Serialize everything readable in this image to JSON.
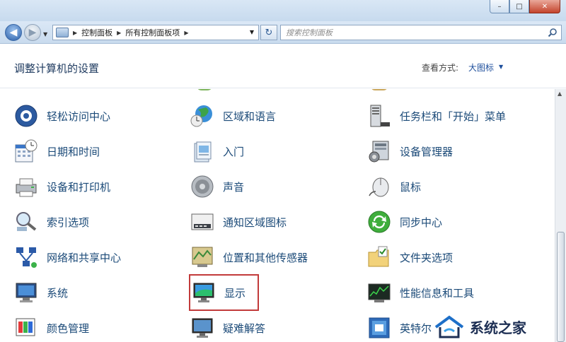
{
  "titlebar": {
    "minimize_symbol": "–",
    "maximize_symbol": "□",
    "close_symbol": "✕"
  },
  "address": {
    "back_symbol": "◀",
    "forward_symbol": "▶",
    "crumbs": [
      "控制面板",
      "所有控制面板项"
    ],
    "refresh_symbol": "↻",
    "search_placeholder": "搜索控制面板"
  },
  "header": {
    "title": "调整计算机的设置",
    "view_label": "查看方式:",
    "view_value": "大图标"
  },
  "items": [
    {
      "label": "轻松访问中心",
      "icon": "ease-of-access-icon"
    },
    {
      "label": "区域和语言",
      "icon": "region-language-icon"
    },
    {
      "label": "任务栏和「开始」菜单",
      "icon": "taskbar-icon"
    },
    {
      "label": "日期和时间",
      "icon": "date-time-icon"
    },
    {
      "label": "入门",
      "icon": "getting-started-icon"
    },
    {
      "label": "设备管理器",
      "icon": "device-manager-icon"
    },
    {
      "label": "设备和打印机",
      "icon": "printer-icon"
    },
    {
      "label": "声音",
      "icon": "speaker-icon"
    },
    {
      "label": "鼠标",
      "icon": "mouse-icon"
    },
    {
      "label": "索引选项",
      "icon": "indexing-icon"
    },
    {
      "label": "通知区域图标",
      "icon": "notification-icon"
    },
    {
      "label": "同步中心",
      "icon": "sync-icon"
    },
    {
      "label": "网络和共享中心",
      "icon": "network-icon"
    },
    {
      "label": "位置和其他传感器",
      "icon": "location-sensor-icon"
    },
    {
      "label": "文件夹选项",
      "icon": "folder-options-icon"
    },
    {
      "label": "系统",
      "icon": "system-icon"
    },
    {
      "label": "显示",
      "icon": "display-icon"
    },
    {
      "label": "性能信息和工具",
      "icon": "performance-icon"
    },
    {
      "label": "颜色管理",
      "icon": "color-management-icon"
    },
    {
      "label": "疑难解答",
      "icon": "troubleshooting-icon"
    },
    {
      "label": "英特尔",
      "icon": "intel-icon"
    }
  ],
  "watermark": {
    "text": "系统之家"
  },
  "colors": {
    "link": "#1b4a78",
    "highlight_box": "#c23a3a",
    "titlebar": "#d9e7f5"
  }
}
